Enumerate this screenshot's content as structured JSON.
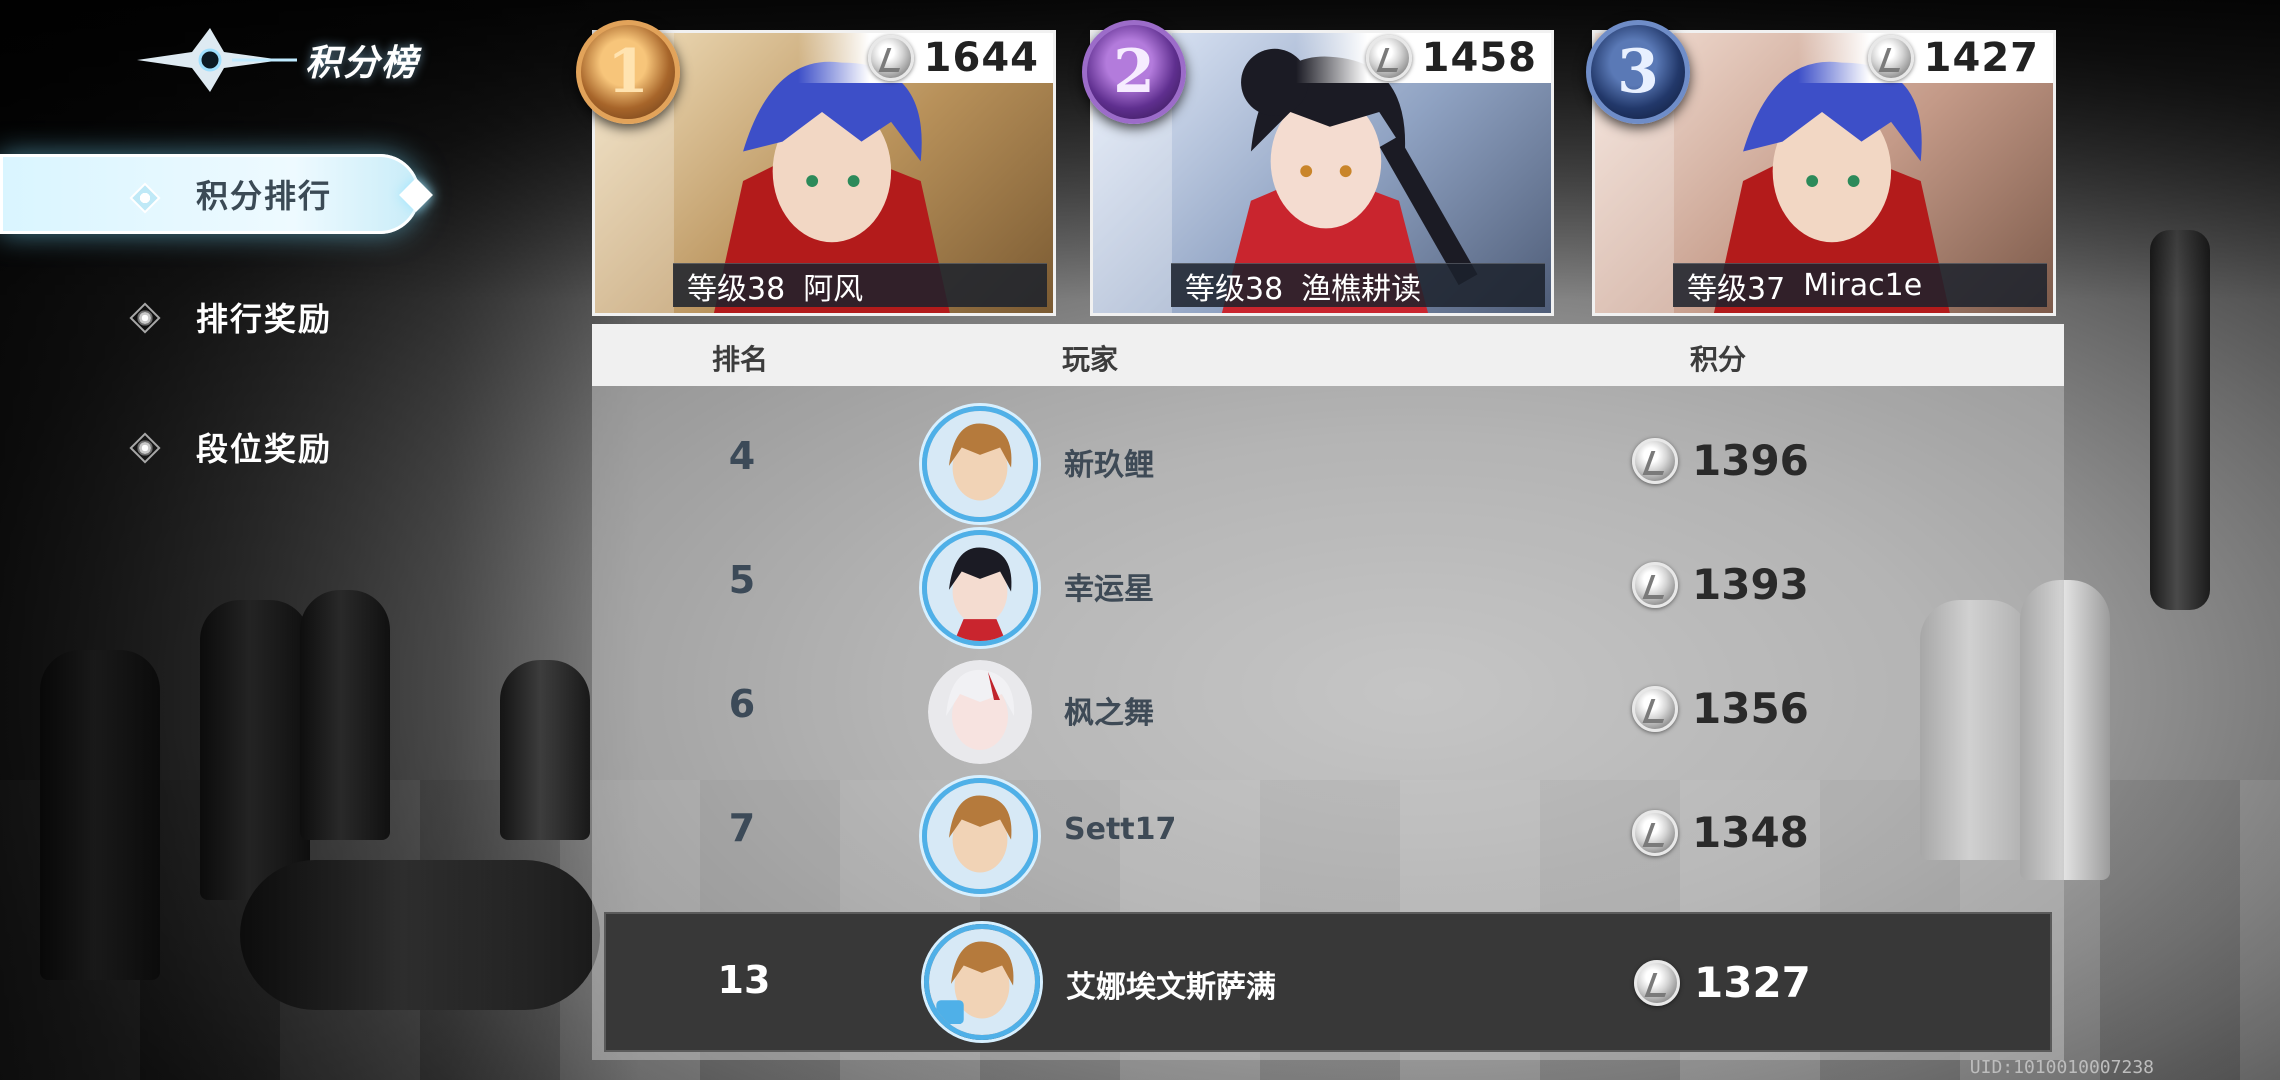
{
  "header": {
    "title": "积分榜"
  },
  "sidebar": {
    "items": [
      {
        "label": "积分排行",
        "active": true
      },
      {
        "label": "排行奖励",
        "active": false
      },
      {
        "label": "段位奖励",
        "active": false
      }
    ]
  },
  "podium": [
    {
      "rank": "1",
      "score": "1644",
      "level": "等级38",
      "name": "阿风",
      "hair": "#3d4fc8",
      "bg": "#b8915a"
    },
    {
      "rank": "2",
      "score": "1458",
      "level": "等级38",
      "name": "渔樵耕读",
      "hair": "#1b1b24",
      "bg": "#8fa2c2"
    },
    {
      "rank": "3",
      "score": "1427",
      "level": "等级37",
      "name": "Mirac1e",
      "hair": "#3d4fc8",
      "bg": "#c49a88"
    }
  ],
  "table": {
    "headers": {
      "rank": "排名",
      "player": "玩家",
      "score": "积分"
    },
    "rows": [
      {
        "rank": "4",
        "name": "新玖鲤",
        "score": "1396"
      },
      {
        "rank": "5",
        "name": "幸运星",
        "score": "1393"
      },
      {
        "rank": "6",
        "name": "枫之舞",
        "score": "1356"
      },
      {
        "rank": "7",
        "name": "Sett17",
        "score": "1348"
      }
    ],
    "self": {
      "rank": "13",
      "name": "艾娜埃文斯萨满",
      "score": "1327"
    }
  },
  "footer": {
    "uid": "UID:1010010007238"
  },
  "colors": {
    "accent": "#4fb0e8",
    "active_tab": "#e6f8ff",
    "self_row": "#383838"
  }
}
